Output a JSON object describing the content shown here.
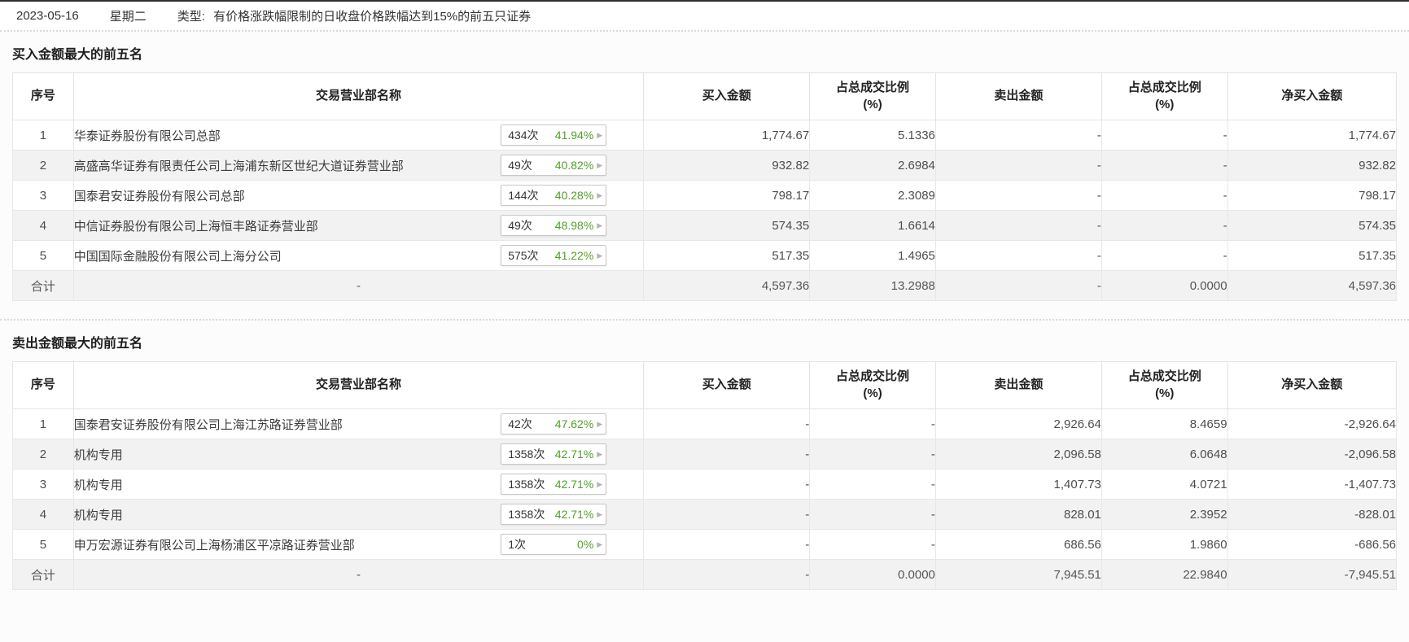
{
  "header": {
    "date": "2023-05-16",
    "weekday": "星期二",
    "type_label": "类型:",
    "type_text": "有价格涨跌幅限制的日收盘价格跌幅达到15%的前五只证券"
  },
  "columns": {
    "no": "序号",
    "name": "交易营业部名称",
    "buy": "买入金额",
    "ratio_line1": "占总成交比例",
    "ratio_line2": "(%)",
    "sell": "卖出金额",
    "net": "净买入金额"
  },
  "badge_arrow": "▶",
  "colors": {
    "buy_red": "#e9403f",
    "sell_green": "#35a035",
    "badge_pct_green": "#4fa029"
  },
  "buy": {
    "title": "买入金额最大的前五名",
    "rows": [
      {
        "no": "1",
        "name": "华泰证券股份有限公司总部",
        "count": "434次",
        "pct": "41.94%",
        "buy": "1,774.67",
        "buy_ratio": "5.1336",
        "sell": "-",
        "sell_ratio": "-",
        "net": "1,774.67"
      },
      {
        "no": "2",
        "name": "高盛高华证券有限责任公司上海浦东新区世纪大道证券营业部",
        "count": "49次",
        "pct": "40.82%",
        "buy": "932.82",
        "buy_ratio": "2.6984",
        "sell": "-",
        "sell_ratio": "-",
        "net": "932.82"
      },
      {
        "no": "3",
        "name": "国泰君安证券股份有限公司总部",
        "count": "144次",
        "pct": "40.28%",
        "buy": "798.17",
        "buy_ratio": "2.3089",
        "sell": "-",
        "sell_ratio": "-",
        "net": "798.17"
      },
      {
        "no": "4",
        "name": "中信证券股份有限公司上海恒丰路证券营业部",
        "count": "49次",
        "pct": "48.98%",
        "buy": "574.35",
        "buy_ratio": "1.6614",
        "sell": "-",
        "sell_ratio": "-",
        "net": "574.35"
      },
      {
        "no": "5",
        "name": "中国国际金融股份有限公司上海分公司",
        "count": "575次",
        "pct": "41.22%",
        "buy": "517.35",
        "buy_ratio": "1.4965",
        "sell": "-",
        "sell_ratio": "-",
        "net": "517.35"
      }
    ],
    "total": {
      "no": "合计",
      "name": "-",
      "buy": "4,597.36",
      "buy_ratio": "13.2988",
      "sell": "-",
      "sell_ratio": "0.0000",
      "net": "4,597.36"
    }
  },
  "sell": {
    "title": "卖出金额最大的前五名",
    "rows": [
      {
        "no": "1",
        "name": "国泰君安证券股份有限公司上海江苏路证券营业部",
        "count": "42次",
        "pct": "47.62%",
        "buy": "-",
        "buy_ratio": "-",
        "sell": "2,926.64",
        "sell_ratio": "8.4659",
        "net": "-2,926.64"
      },
      {
        "no": "2",
        "name": "机构专用",
        "count": "1358次",
        "pct": "42.71%",
        "buy": "-",
        "buy_ratio": "-",
        "sell": "2,096.58",
        "sell_ratio": "6.0648",
        "net": "-2,096.58"
      },
      {
        "no": "3",
        "name": "机构专用",
        "count": "1358次",
        "pct": "42.71%",
        "buy": "-",
        "buy_ratio": "-",
        "sell": "1,407.73",
        "sell_ratio": "4.0721",
        "net": "-1,407.73"
      },
      {
        "no": "4",
        "name": "机构专用",
        "count": "1358次",
        "pct": "42.71%",
        "buy": "-",
        "buy_ratio": "-",
        "sell": "828.01",
        "sell_ratio": "2.3952",
        "net": "-828.01"
      },
      {
        "no": "5",
        "name": "申万宏源证券有限公司上海杨浦区平凉路证券营业部",
        "count": "1次",
        "pct": "0%",
        "buy": "-",
        "buy_ratio": "-",
        "sell": "686.56",
        "sell_ratio": "1.9860",
        "net": "-686.56"
      }
    ],
    "total": {
      "no": "合计",
      "name": "-",
      "buy": "-",
      "buy_ratio": "0.0000",
      "sell": "7,945.51",
      "sell_ratio": "22.9840",
      "net": "-7,945.51"
    }
  }
}
